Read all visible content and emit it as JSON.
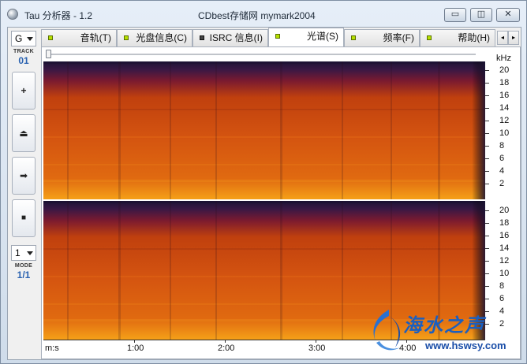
{
  "window": {
    "app_title": "Tau 分析器 - 1.2",
    "center_title": "CDbest存储网 mymark2004",
    "min_label": "▭",
    "max_label": "◫",
    "close_label": "✕"
  },
  "toolbar": {
    "track_select": "G",
    "track_label": "TRACK",
    "track_value": "01",
    "add_symbol": "+",
    "eject_symbol": "⏏",
    "play_symbol": "➡",
    "stop_symbol": "■",
    "mode_select": "1",
    "mode_label": "MODE",
    "mode_value": "1/1"
  },
  "tabs": [
    {
      "label": "音轨(T)",
      "led": "green"
    },
    {
      "label": "光盘信息(C)",
      "led": "green"
    },
    {
      "label": "ISRC 信息(I)",
      "led": "dark"
    },
    {
      "label": "光谱(S)",
      "led": "green",
      "active": true
    },
    {
      "label": "频率(F)",
      "led": "green"
    },
    {
      "label": "帮助(H)",
      "led": "green"
    }
  ],
  "tab_scroll": {
    "left": "◂",
    "right": "▸"
  },
  "spectrum": {
    "freq_unit": "kHz",
    "y_ticks": [
      "20",
      "18",
      "16",
      "14",
      "12",
      "10",
      "8",
      "6",
      "4",
      "2"
    ],
    "x_ticks": [
      "m:s",
      "1:00",
      "2:00",
      "3:00",
      "4:00"
    ],
    "colors": {
      "hot": "#f08a10",
      "mid": "#d0460c",
      "cool": "#7a1a30",
      "cold": "#1c1436"
    }
  },
  "watermark": {
    "text": "海水之声",
    "url": "www.hswsy.com"
  }
}
